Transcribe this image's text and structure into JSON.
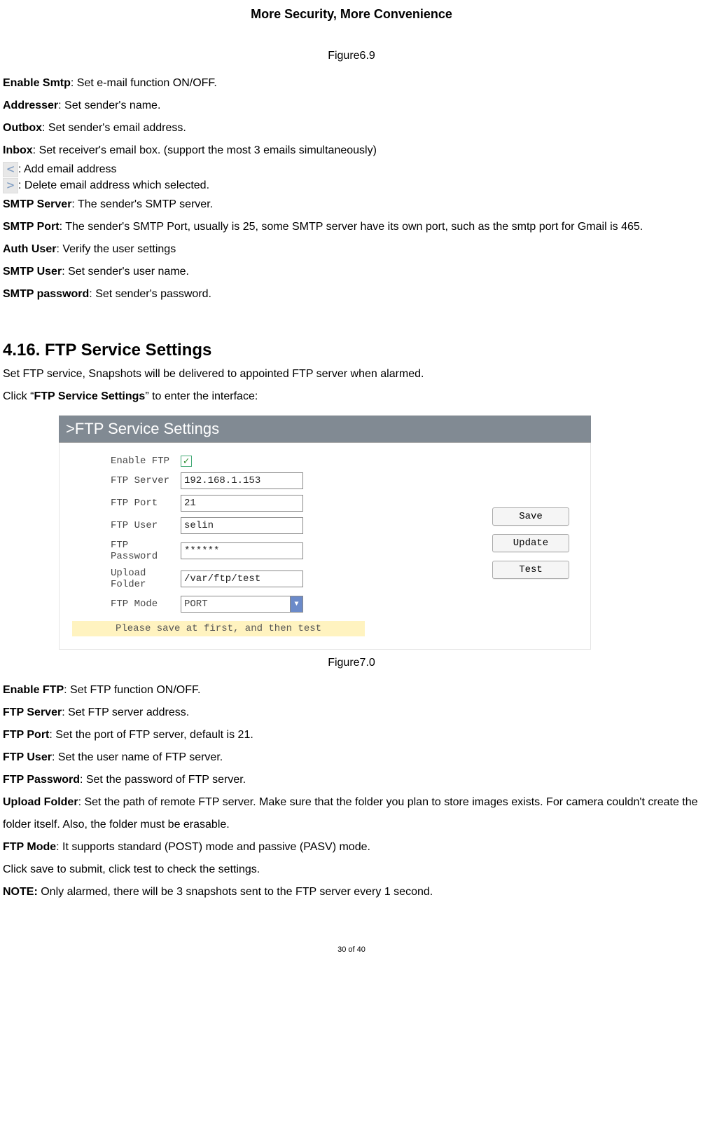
{
  "header": "More Security, More Convenience",
  "figure69_caption": "Figure6.9",
  "smtp_definitions": [
    {
      "term": "Enable Smtp",
      "desc": ": Set e-mail function ON/OFF."
    },
    {
      "term": "Addresser",
      "desc": ": Set sender's name."
    },
    {
      "term": "Outbox",
      "desc": ": Set sender's email address."
    },
    {
      "term": "Inbox",
      "desc": ": Set receiver's email box. (support the most 3 emails simultaneously)"
    }
  ],
  "icon_add_desc": ": Add email address",
  "icon_del_desc": ": Delete email address which selected.",
  "smtp_definitions2": [
    {
      "term": "SMTP Server",
      "desc": ": The sender's SMTP server."
    },
    {
      "term": "SMTP Port",
      "desc": ": The sender's SMTP Port, usually is 25, some SMTP server have its own port, such as the smtp port for Gmail is 465."
    },
    {
      "term": "Auth User",
      "desc": ": Verify the user settings"
    },
    {
      "term": "SMTP User",
      "desc": ": Set sender's user name."
    },
    {
      "term": "SMTP password",
      "desc": ": Set sender's password."
    }
  ],
  "section_heading": "4.16. FTP Service Settings",
  "ftp_intro1": "Set FTP service, Snapshots will be delivered to appointed FTP server when alarmed.",
  "ftp_intro2a": "Click “",
  "ftp_intro2b": "FTP Service Settings",
  "ftp_intro2c": "” to enter the interface:",
  "ui": {
    "title_prefix": ">",
    "title": "FTP Service Settings",
    "labels": {
      "enable": "Enable FTP",
      "server": "FTP Server",
      "port": "FTP Port",
      "user": "FTP User",
      "password": "FTP Password",
      "folder": "Upload Folder",
      "mode": "FTP Mode"
    },
    "values": {
      "server": "192.168.1.153",
      "port": "21",
      "user": "selin",
      "password": "******",
      "folder": "/var/ftp/test",
      "mode": "PORT"
    },
    "checkmark": "✓",
    "dropdown_arrow": "▼",
    "buttons": {
      "save": "Save",
      "update": "Update",
      "test": "Test"
    },
    "hint": "Please save at first, and then test"
  },
  "figure70_caption": "Figure7.0",
  "ftp_definitions": [
    {
      "term": "Enable FTP",
      "desc": ": Set FTP function ON/OFF."
    },
    {
      "term": "FTP Server",
      "desc": ": Set FTP server address."
    },
    {
      "term": "FTP Port",
      "desc": ": Set the port of FTP server, default is 21."
    },
    {
      "term": "FTP User",
      "desc": ": Set the user name of FTP server."
    },
    {
      "term": "FTP Password",
      "desc": ": Set the password of FTP server."
    },
    {
      "term": "Upload Folder",
      "desc": ": Set the path of remote FTP server. Make sure that the folder you plan to store images exists. For camera couldn't create the folder itself. Also, the folder must be erasable."
    },
    {
      "term": "FTP Mode",
      "desc": ": It supports standard (POST) mode and passive (PASV) mode."
    }
  ],
  "ftp_post1": "Click save to submit, click test to check the settings.",
  "ftp_note_term": "NOTE:",
  "ftp_note_desc": " Only alarmed, there will be 3 snapshots sent to the FTP server every 1 second.",
  "footer": "30 of 40"
}
